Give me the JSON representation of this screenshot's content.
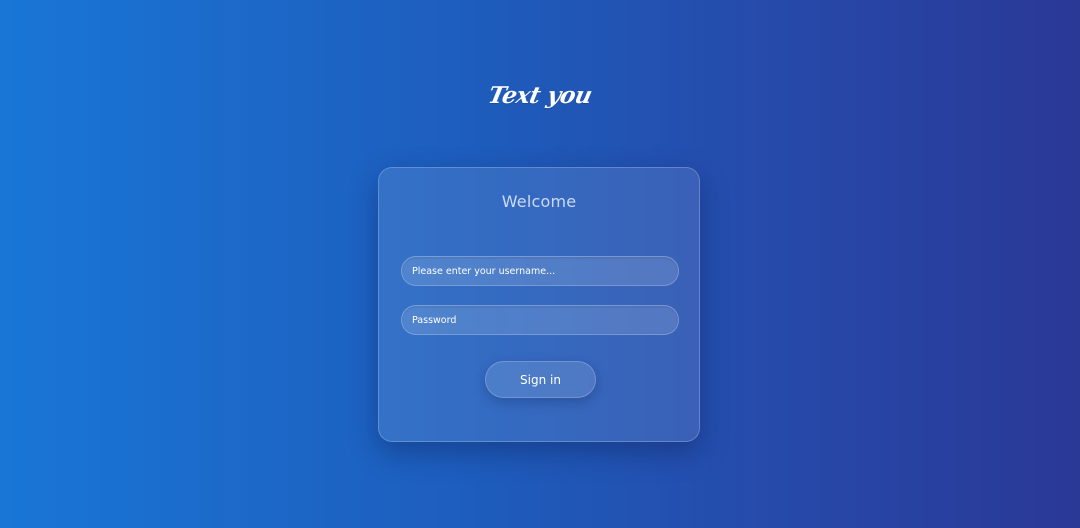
{
  "brand": {
    "logo_text": "Text you"
  },
  "login_card": {
    "title": "Welcome",
    "username_placeholder": "Please enter your username...",
    "password_placeholder": "Password",
    "signin_label": "Sign in"
  },
  "colors": {
    "background_start": "#1976d6",
    "background_end": "#2a3896",
    "text": "#ffffff"
  }
}
